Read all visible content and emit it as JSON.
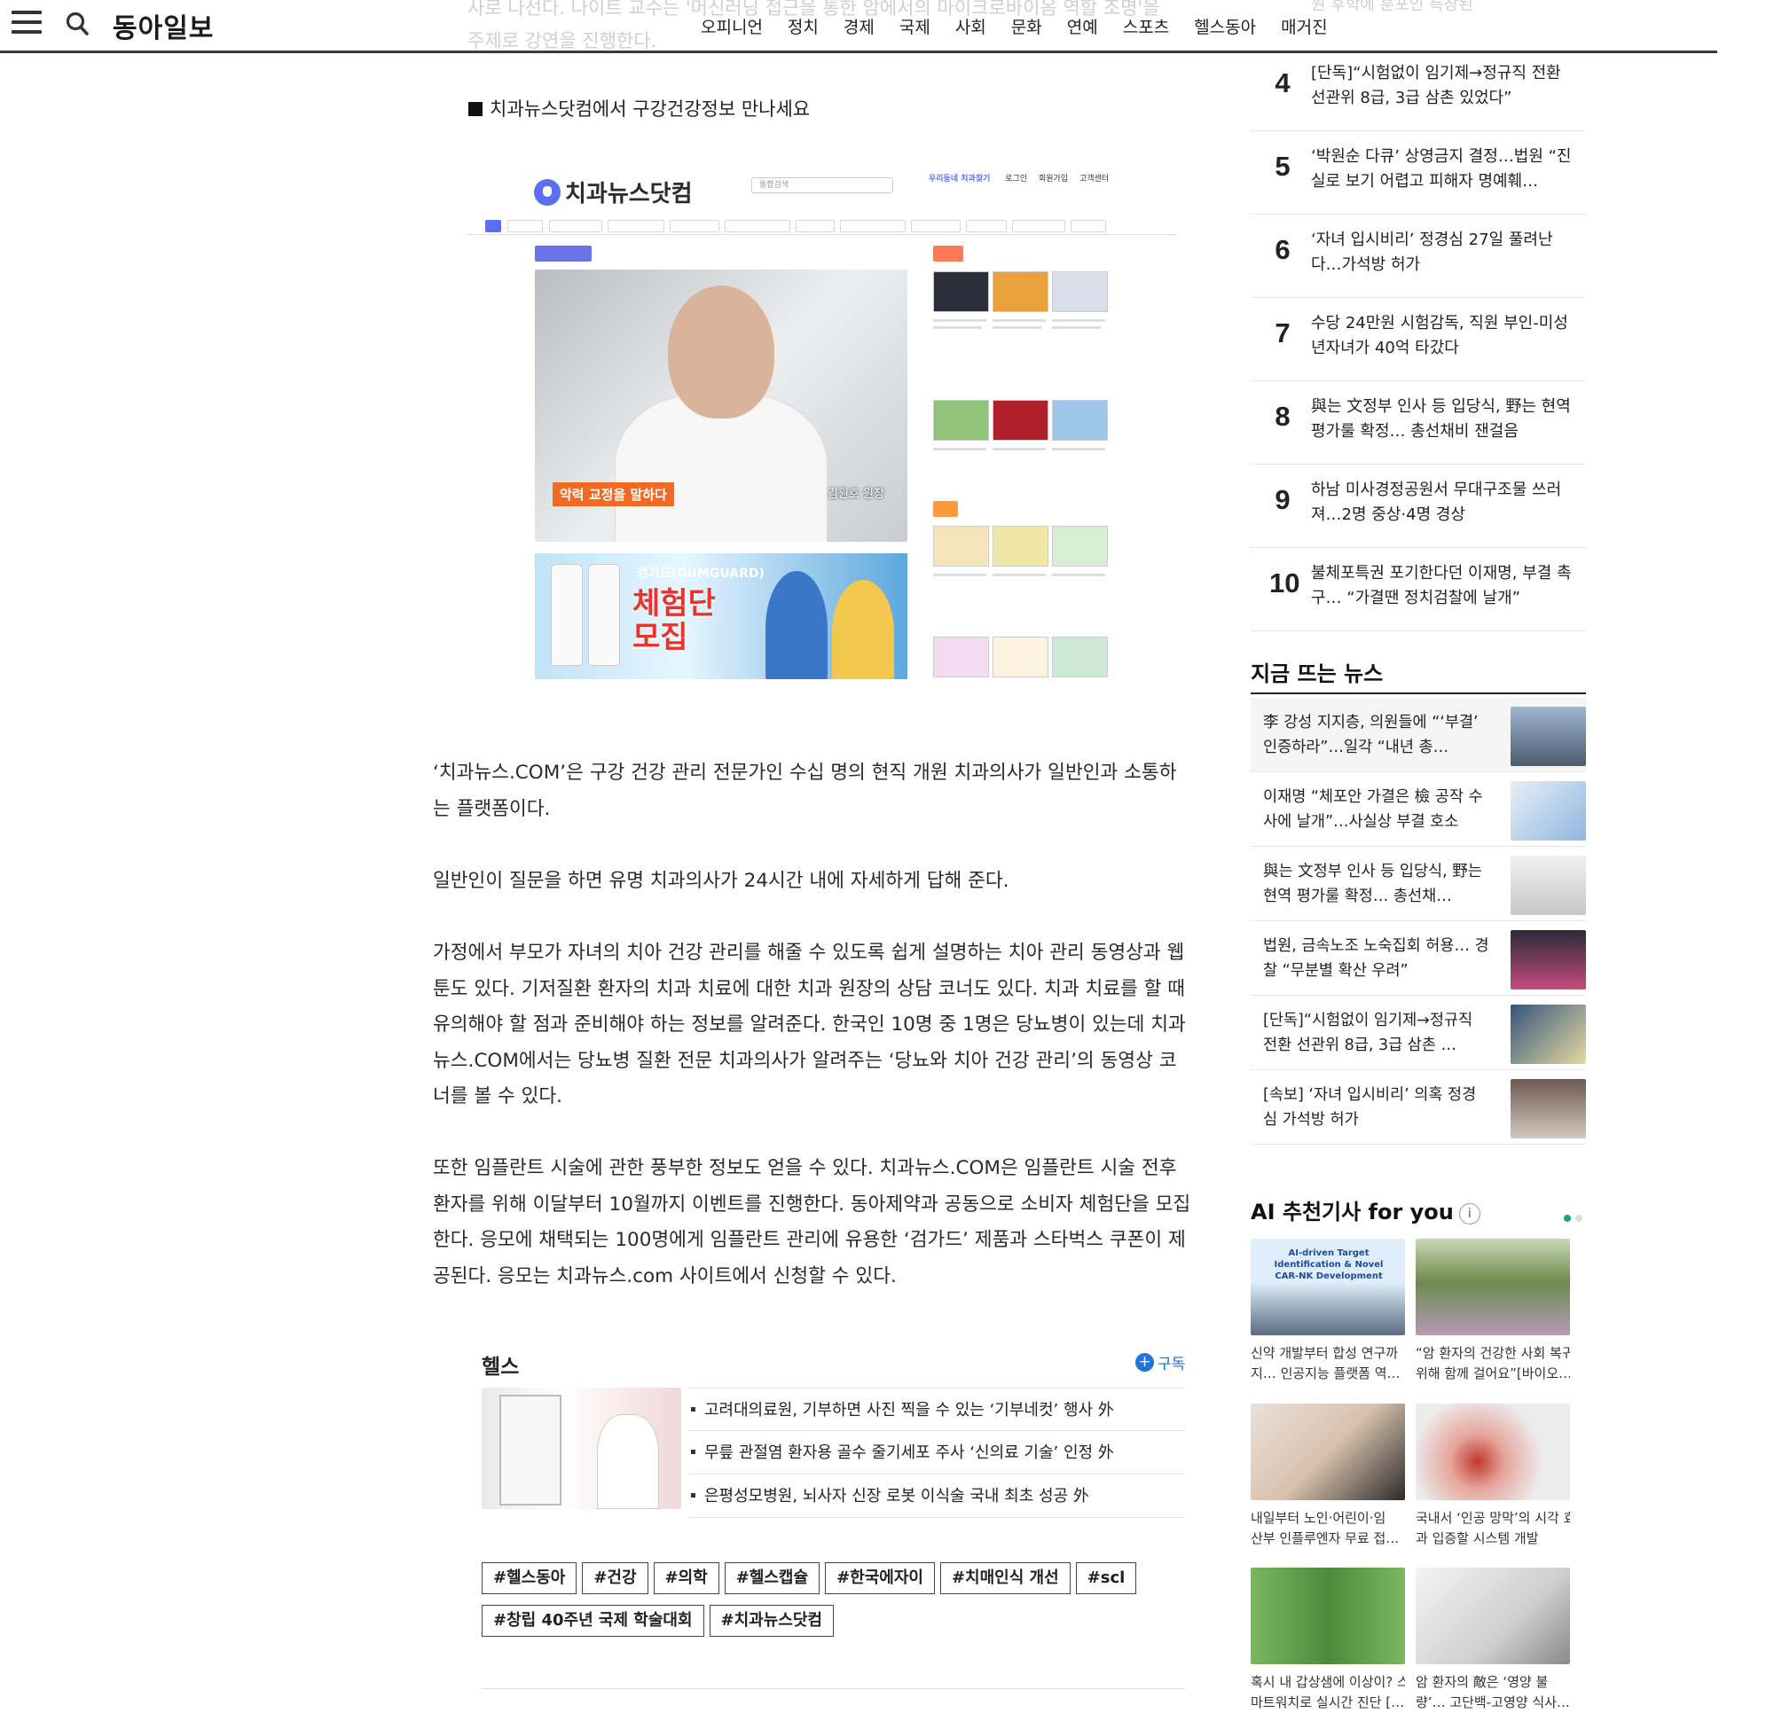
{
  "header": {
    "logo": "동아일보",
    "nav": [
      "오피니언",
      "정치",
      "경제",
      "국제",
      "사회",
      "문화",
      "연예",
      "스포츠",
      "헬스동아",
      "매거진"
    ]
  },
  "faded_text": {
    "article_line1": "사로 나선다. 나이트 교수는 '머신러닝 접근을 통한 암에서의 마이크로바이옴 역할 조명'을",
    "article_line2": "주제로 강연을 진행한다.",
    "rail_line": "원 후학에 훈포인 특장된"
  },
  "article": {
    "section_heading": "치과뉴스닷컴에서 구강건강정보 만나세요",
    "embedded_screenshot": {
      "site_logo": "치과뉴스닷컴",
      "search_placeholder": "통합검색",
      "top_links": [
        "우리동네 치과찾기",
        "로그인",
        "회원가입",
        "고객센터"
      ],
      "hero_badge": "악력 교정을 말하다",
      "hero_caption": "김원호 원장",
      "ad_brand": "검가드(GUMGUARD)",
      "ad_title_line1": "체험단",
      "ad_title_line2": "모집"
    },
    "paragraphs": [
      "‘치과뉴스.COM’은 구강 건강 관리 전문가인 수십 명의 현직 개원 치과의사가 일반인과 소통하는 플랫폼이다.",
      "일반인이 질문을 하면 유명 치과의사가 24시간 내에 자세하게 답해 준다.",
      "가정에서 부모가 자녀의 치아 건강 관리를 해줄 수 있도록 쉽게 설명하는 치아 관리 동영상과 웹툰도 있다. 기저질환 환자의 치과 치료에 대한 치과 원장의 상담 코너도 있다. 치과 치료를 할 때 유의해야 할 점과 준비해야 하는 정보를 알려준다. 한국인 10명 중 1명은 당뇨병이 있는데 치과뉴스.COM에서는 당뇨병 질환 전문 치과의사가 알려주는 ‘당뇨와 치아 건강 관리’의 동영상 코너를 볼 수 있다.",
      "또한 임플란트 시술에 관한 풍부한 정보도 얻을 수 있다. 치과뉴스.COM은 임플란트 시술 전후 환자를 위해 이달부터 10월까지 이벤트를 진행한다. 동아제약과 공동으로 소비자 체험단을 모집한다. 응모에 채택되는 100명에게 임플란트 관리에 유용한 ‘검가드’ 제품과 스타벅스 쿠폰이 제공된다. 응모는 치과뉴스.com 사이트에서 신청할 수 있다."
    ]
  },
  "health_box": {
    "title": "헬스",
    "subscribe": "구독",
    "items": [
      "고려대의료원, 기부하면 사진 찍을 수 있는 ‘기부네컷’ 행사 外",
      "무릎 관절염 환자용 골수 줄기세포 주사 ‘신의료 기술’ 인정 外",
      "은평성모병원, 뇌사자 신장 로봇 이식술 국내 최초 성공 外"
    ]
  },
  "tags": [
    "#헬스동아",
    "#건강",
    "#의학",
    "#헬스캡슐",
    "#한국에자이",
    "#치매인식 개선",
    "#scl",
    "#창립 40주년 국제 학술대회",
    "#치과뉴스닷컴"
  ],
  "ranking": [
    {
      "num": "4",
      "title": "[단독]“시험없이 임기제→정규직 전환 선관위 8급, 3급 삼촌 있었다”"
    },
    {
      "num": "5",
      "title": "‘박원순 다큐’ 상영금지 결정…법원 “진실로 보기 어렵고 피해자 명예훼…"
    },
    {
      "num": "6",
      "title": "‘자녀 입시비리’ 정경심 27일 풀려난다…가석방 허가"
    },
    {
      "num": "7",
      "title": "수당 24만원 시험감독, 직원 부인-미성년자녀가 40억 타갔다"
    },
    {
      "num": "8",
      "title": "與는 文정부 인사 등 입당식, 野는 현역 평가룰 확정… 총선채비 잰걸음"
    },
    {
      "num": "9",
      "title": "하남 미사경정공원서 무대구조물 쓰러져…2명 중상·4명 경상"
    },
    {
      "num": "10",
      "title": "불체포특권 포기한다던 이재명, 부결 촉구… “가결땐 정치검찰에 날개”"
    }
  ],
  "trending": {
    "heading": "지금 뜨는 뉴스",
    "items": [
      "李 강성 지지층, 의원들에 “‘부결’ 인증하라”…일각 “내년 총…",
      "이재명 “체포안 가결은 檢 공작 수사에 날개”…사실상 부결 호소",
      "與는 文정부 인사 등 입당식, 野는 현역 평가룰 확정… 총선채…",
      "법원, 금속노조 노숙집회 허용… 경찰 “무분별 확산 우려”",
      "[단독]“시험없이 임기제→정규직 전환 선관위 8급, 3급 삼촌 …",
      "[속보] ‘자녀 입시비리’ 의혹 정경심 가석방 허가"
    ]
  },
  "ai": {
    "heading": "AI 추천기사 for you",
    "info": "i",
    "cards": [
      [
        "신약 개발부터 합성 연구까",
        "지… 인공지능 플랫폼 역…"
      ],
      [
        "“암 환자의 건강한 사회 복귀",
        "위해 함께 걸어요”[바이오…"
      ],
      [
        "내일부터 노인·어린이·임",
        "산부 인플루엔자 무료 접…"
      ],
      [
        "국내서 ‘인공 망막’의 시각 효",
        "과 입증할 시스템 개발"
      ],
      [
        "혹시 내 갑상샘에 이상이? 스",
        "마트워치로 실시간 진단 […"
      ],
      [
        "암 환자의 敵은 ‘영양 불",
        "량’… 고단백-고영양 식사…"
      ]
    ],
    "card1_overlay": "AI-driven Target Identification & Novel CAR-NK Development"
  }
}
